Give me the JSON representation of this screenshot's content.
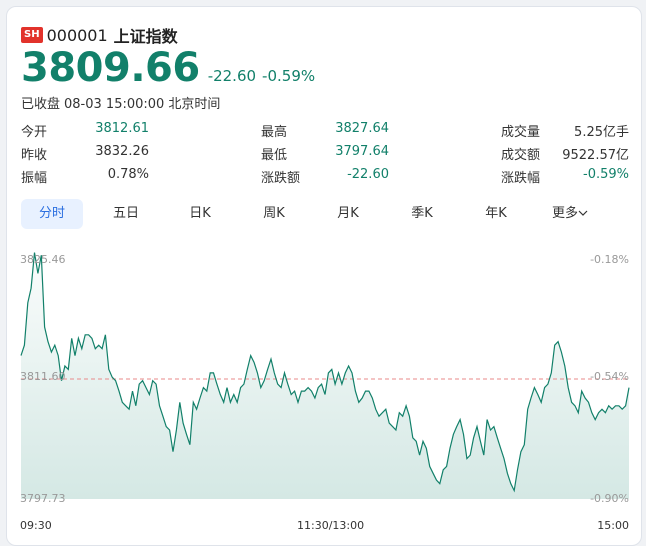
{
  "quote": {
    "exchange_badge": "SH",
    "code": "000001",
    "name": "上证指数",
    "price": "3809.66",
    "change": "-22.60",
    "change_pct": "-0.59%",
    "status": "已收盘",
    "datetime": "08-03 15:00:00",
    "timezone": "北京时间"
  },
  "stats": [
    [
      {
        "label": "今开",
        "value": "3812.61",
        "tone": "green"
      },
      {
        "label": "最高",
        "value": "3827.64",
        "tone": "green"
      },
      {
        "label": "成交量",
        "value": "5.25亿手",
        "tone": "dark"
      }
    ],
    [
      {
        "label": "昨收",
        "value": "3832.26",
        "tone": "dark"
      },
      {
        "label": "最低",
        "value": "3797.64",
        "tone": "green"
      },
      {
        "label": "成交额",
        "value": "9522.57亿",
        "tone": "dark"
      }
    ],
    [
      {
        "label": "振幅",
        "value": "0.78%",
        "tone": "dark"
      },
      {
        "label": "涨跌额",
        "value": "-22.60",
        "tone": "green"
      },
      {
        "label": "涨跌幅",
        "value": "-0.59%",
        "tone": "green"
      }
    ]
  ],
  "tabs": [
    {
      "label": "分时",
      "active": true
    },
    {
      "label": "五日",
      "active": false
    },
    {
      "label": "日K",
      "active": false
    },
    {
      "label": "周K",
      "active": false
    },
    {
      "label": "月K",
      "active": false
    },
    {
      "label": "季K",
      "active": false
    },
    {
      "label": "年K",
      "active": false
    },
    {
      "label": "更多",
      "active": false
    }
  ],
  "colors": {
    "accent": "#12806a",
    "badge": "#e2322b",
    "reference_line": "#e88a8a",
    "tab_active": "#2b6fe0"
  },
  "chart_data": {
    "type": "line",
    "y_left_ticks": [
      "3825.46",
      "3811.60",
      "3797.73"
    ],
    "y_right_ticks": [
      "-0.18%",
      "-0.54%",
      "-0.90%"
    ],
    "x_ticks": [
      "09:30",
      "11:30/13:00",
      "15:00"
    ],
    "reference_value": 3811.6,
    "ylim": [
      3797.73,
      3825.46
    ],
    "values": [
      3814.3,
      3815.5,
      3820.4,
      3822.1,
      3826.2,
      3823.8,
      3825.9,
      3817.6,
      3815.9,
      3814.7,
      3815.5,
      3814.3,
      3811.4,
      3813.1,
      3812.7,
      3816.3,
      3814.3,
      3816.3,
      3815.1,
      3816.7,
      3816.7,
      3816.3,
      3815.1,
      3815.5,
      3815.1,
      3816.7,
      3812.7,
      3811.8,
      3811.4,
      3810.2,
      3808.9,
      3808.5,
      3808.1,
      3810.2,
      3808.5,
      3811.0,
      3811.4,
      3810.6,
      3809.8,
      3811.4,
      3811.0,
      3808.5,
      3807.3,
      3806.1,
      3805.7,
      3803.2,
      3805.7,
      3808.9,
      3806.5,
      3805.2,
      3804.0,
      3808.9,
      3808.1,
      3809.4,
      3810.6,
      3810.2,
      3812.3,
      3812.3,
      3811.0,
      3809.8,
      3808.9,
      3810.6,
      3808.9,
      3809.8,
      3808.9,
      3810.6,
      3811.0,
      3812.7,
      3814.3,
      3813.5,
      3812.3,
      3810.6,
      3811.4,
      3812.7,
      3813.9,
      3812.3,
      3811.0,
      3810.6,
      3812.3,
      3811.0,
      3809.8,
      3810.2,
      3808.9,
      3810.2,
      3810.2,
      3810.6,
      3810.2,
      3809.4,
      3810.6,
      3811.0,
      3809.8,
      3812.3,
      3812.7,
      3811.0,
      3812.3,
      3811.0,
      3812.3,
      3813.1,
      3812.3,
      3810.2,
      3808.9,
      3809.4,
      3810.2,
      3810.2,
      3809.4,
      3808.1,
      3807.3,
      3807.7,
      3808.1,
      3806.5,
      3806.1,
      3805.7,
      3807.7,
      3807.3,
      3808.5,
      3807.3,
      3804.8,
      3804.4,
      3802.8,
      3804.4,
      3803.6,
      3801.5,
      3800.7,
      3799.9,
      3799.5,
      3801.1,
      3801.5,
      3803.6,
      3805.2,
      3806.1,
      3806.9,
      3805.2,
      3802.4,
      3802.8,
      3804.8,
      3806.1,
      3804.4,
      3802.8,
      3806.9,
      3805.7,
      3806.1,
      3804.8,
      3803.6,
      3802.4,
      3800.7,
      3799.5,
      3798.7,
      3801.1,
      3803.2,
      3804.0,
      3808.1,
      3809.4,
      3810.6,
      3809.8,
      3808.9,
      3810.6,
      3811.0,
      3812.3,
      3815.5,
      3815.9,
      3814.7,
      3813.1,
      3810.6,
      3808.9,
      3808.5,
      3807.7,
      3810.2,
      3809.4,
      3808.9,
      3807.7,
      3806.9,
      3807.7,
      3808.1,
      3807.7,
      3808.5,
      3808.1,
      3808.5,
      3808.5,
      3808.1,
      3808.5,
      3810.6
    ]
  }
}
